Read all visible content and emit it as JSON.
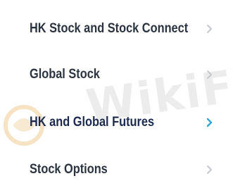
{
  "menu": {
    "items": [
      {
        "label": "HK Stock and Stock Connect",
        "active": false
      },
      {
        "label": "Global Stock",
        "active": false
      },
      {
        "label": "HK and Global Futures",
        "active": true
      },
      {
        "label": "Stock Options",
        "active": false
      }
    ]
  },
  "watermark": {
    "text": "WikiFX"
  },
  "colors": {
    "label": "#2b3340",
    "label_active": "#1b2a4e",
    "chevron": "#c4c8ce",
    "chevron_active": "#2fa8d8",
    "watermark_text": "#ececec",
    "watermark_logo": "#f6e3c4"
  },
  "icons": {
    "chevron": "chevron-right-icon"
  }
}
